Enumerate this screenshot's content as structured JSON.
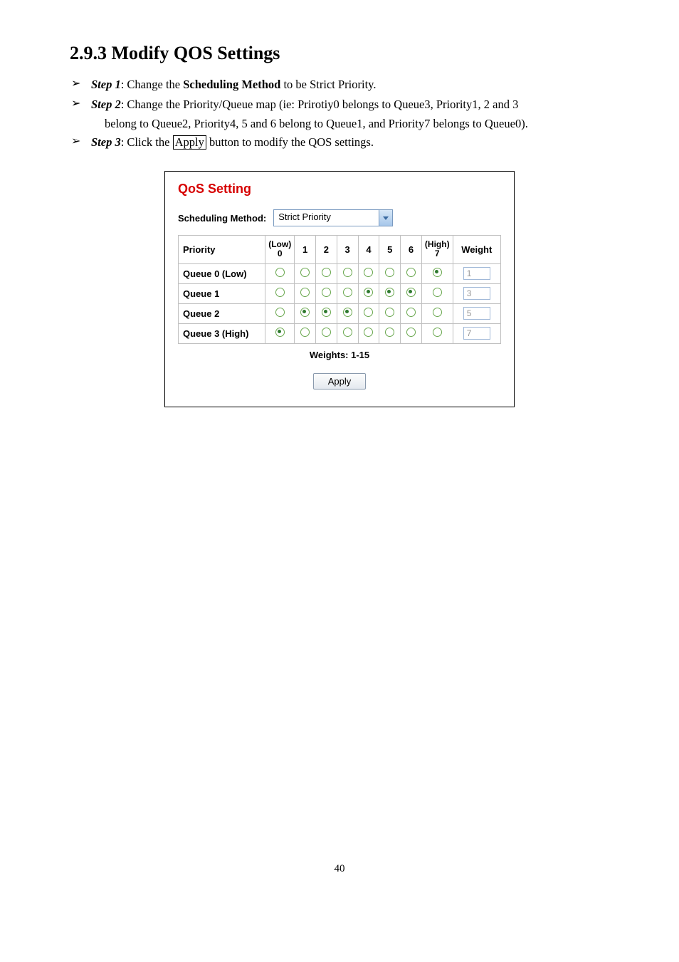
{
  "heading": "2.9.3  Modify QOS Settings",
  "steps": [
    {
      "label": "Step 1",
      "parts": [
        {
          "t": ": Change the "
        },
        {
          "t": "Scheduling Method",
          "bold": true
        },
        {
          "t": " to be Strict Priority."
        }
      ]
    },
    {
      "label": "Step 2",
      "parts": [
        {
          "t": ": Change the Priority/Queue map (ie: Prirotiy0 belongs to Queue3, Priority1, 2 and 3"
        }
      ],
      "subline": "belong to Queue2, Priority4, 5 and 6 belong to Queue1, and Priority7 belongs to Queue0)."
    },
    {
      "label": "Step 3",
      "parts": [
        {
          "t": ": Click the "
        },
        {
          "t": "Apply",
          "boxed": true
        },
        {
          "t": " button to modify the QOS settings."
        }
      ]
    }
  ],
  "panel": {
    "title": "QoS Setting",
    "sched_label": "Scheduling Method:",
    "sched_value": "Strict Priority",
    "headers": {
      "priority": "Priority",
      "low_top": "(Low)",
      "low_bot": "0",
      "c1": "1",
      "c2": "2",
      "c3": "3",
      "c4": "4",
      "c5": "5",
      "c6": "6",
      "high_top": "(High)",
      "high_bot": "7",
      "weight": "Weight"
    },
    "rows": [
      {
        "name": "Queue 0  (Low)",
        "sel": [
          false,
          false,
          false,
          false,
          false,
          false,
          false,
          true
        ],
        "weight": "1"
      },
      {
        "name": "Queue 1",
        "sel": [
          false,
          false,
          false,
          false,
          true,
          true,
          true,
          false
        ],
        "weight": "3"
      },
      {
        "name": "Queue 2",
        "sel": [
          false,
          true,
          true,
          true,
          false,
          false,
          false,
          false
        ],
        "weight": "5"
      },
      {
        "name": "Queue 3  (High)",
        "sel": [
          true,
          false,
          false,
          false,
          false,
          false,
          false,
          false
        ],
        "weight": "7"
      }
    ],
    "weights_label": "Weights: 1-15",
    "apply_label": "Apply"
  },
  "page_number": "40"
}
